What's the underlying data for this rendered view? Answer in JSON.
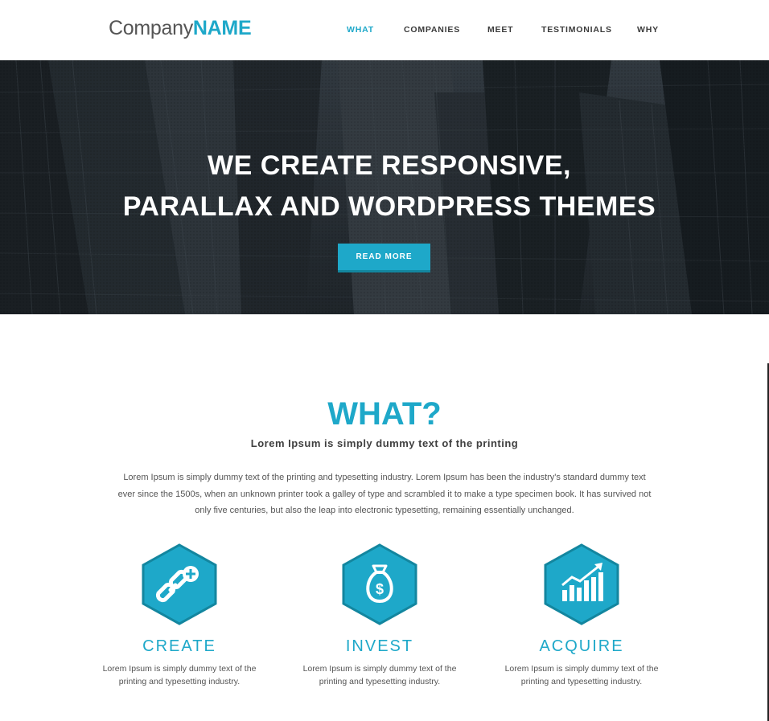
{
  "header": {
    "logo_light": "Company",
    "logo_bold": "NAME",
    "nav": [
      {
        "label": "WHAT",
        "active": true
      },
      {
        "label": "COMPANIES",
        "active": false
      },
      {
        "label": "MEET",
        "active": false
      },
      {
        "label": "TESTIMONIALS",
        "active": false
      },
      {
        "label": "WHY",
        "active": false
      }
    ]
  },
  "hero": {
    "line1": "WE CREATE RESPONSIVE,",
    "line2": "PARALLAX AND WORDPRESS THEMES",
    "button": "READ MORE"
  },
  "what": {
    "title": "WHAT?",
    "subtitle": "Lorem Ipsum is simply dummy text of the printing",
    "body": "Lorem Ipsum is simply dummy text of the printing and typesetting industry. Lorem Ipsum has been the industry's standard dummy text ever since the 1500s, when an unknown printer took a galley of type and scrambled it to make a type specimen book. It has survived not only five centuries, but also the leap into electronic typesetting, remaining essentially unchanged."
  },
  "features": [
    {
      "icon": "link-plus-icon",
      "title": "CREATE",
      "text": "Lorem Ipsum is simply dummy text of the printing and typesetting industry."
    },
    {
      "icon": "money-bag-icon",
      "title": "INVEST",
      "text": "Lorem Ipsum is simply dummy text of the printing and typesetting industry."
    },
    {
      "icon": "growth-chart-icon",
      "title": "ACQUIRE",
      "text": "Lorem Ipsum is simply dummy text of the printing and typesetting industry."
    }
  ],
  "colors": {
    "accent": "#1ea8c9",
    "accent_dark": "#13869f",
    "hero_bg": "#2c343b"
  }
}
